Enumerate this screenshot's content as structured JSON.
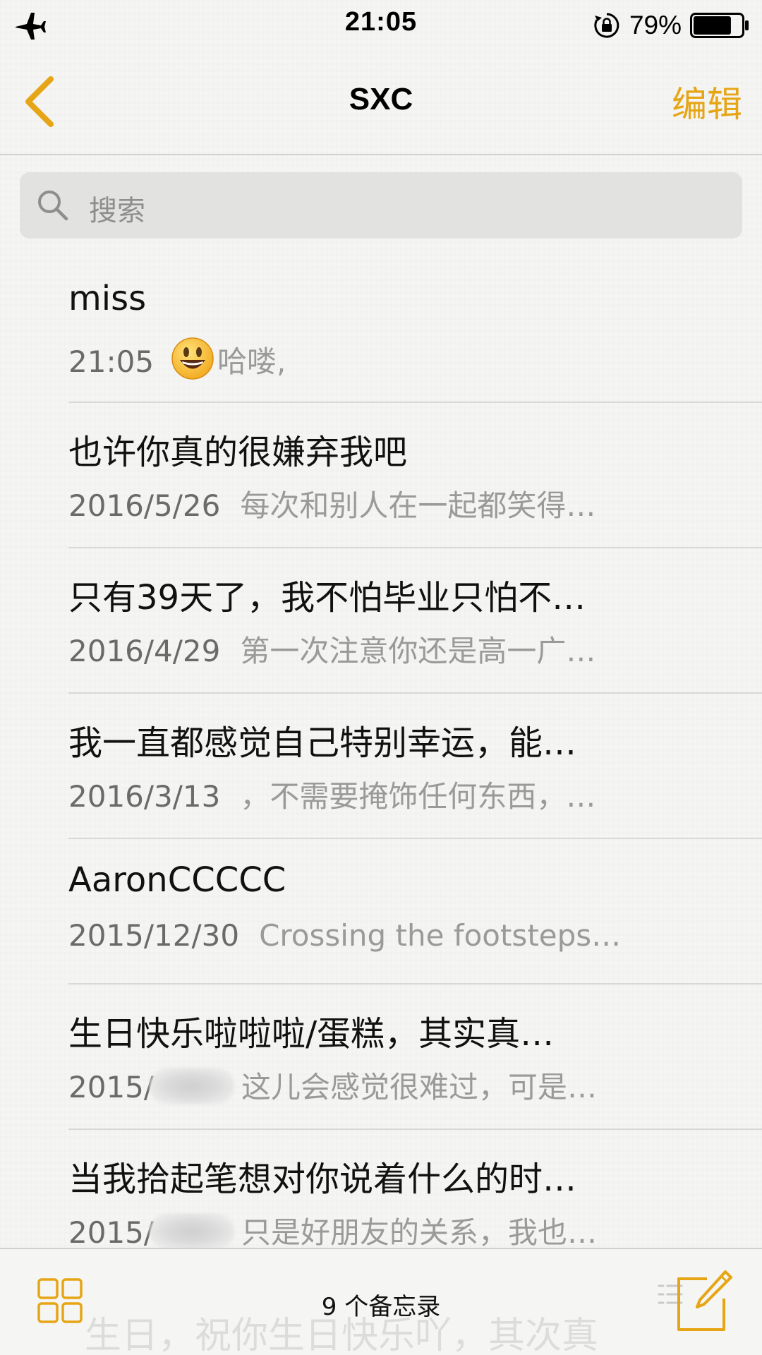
{
  "status_bar": {
    "time": "21:05",
    "battery_percent": "79%",
    "battery_level": 0.79
  },
  "nav": {
    "title": "SXC",
    "edit_label": "编辑"
  },
  "search": {
    "placeholder": "搜索"
  },
  "notes": [
    {
      "title": "miss",
      "date": "21:05",
      "preview": "哈喽,",
      "emoji": "smiley-emoji"
    },
    {
      "title": "也许你真的很嫌弃我吧",
      "date": "2016/5/26",
      "preview": "每次和别人在一起都笑得…"
    },
    {
      "title": "只有39天了，我不怕毕业只怕不…",
      "date": "2016/4/29",
      "preview": "第一次注意你还是高一广…"
    },
    {
      "title": "我一直都感觉自己特别幸运，能…",
      "date": "2016/3/13",
      "preview": "，不需要掩饰任何东西，…"
    },
    {
      "title": "AaronCCCCC",
      "date": "2015/12/30",
      "preview": "Crossing the footsteps…"
    },
    {
      "title": "生日快乐啦啦啦/蛋糕，其实真…",
      "date": "2015/",
      "preview": "这儿会感觉很难过，可是…",
      "redacted": true
    },
    {
      "title": "当我拾起笔想对你说着什么的时…",
      "date": "2015/",
      "preview": "只是好朋友的关系，我也…",
      "redacted": true
    }
  ],
  "toolbar": {
    "count_label": "9 个备忘录",
    "ghost_text": "生日，祝你生日快乐吖，其次真"
  },
  "colors": {
    "accent": "#e6a514"
  }
}
